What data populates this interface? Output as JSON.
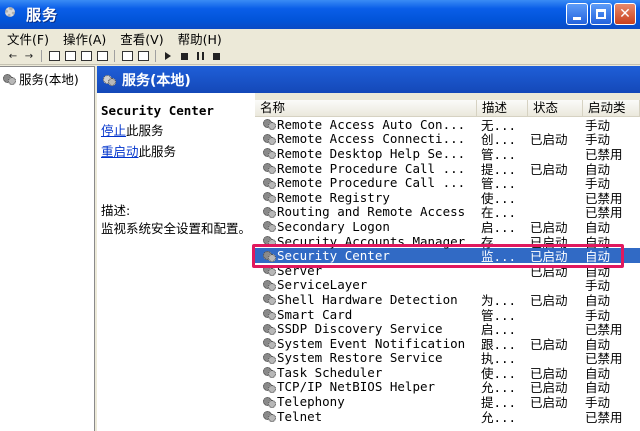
{
  "window": {
    "title": "服务"
  },
  "menu": [
    "文件(F)",
    "操作(A)",
    "查看(V)",
    "帮助(H)"
  ],
  "tree": {
    "root_label": "服务(本地)"
  },
  "panel_header": "服务(本地)",
  "description": {
    "service_name": "Security Center",
    "stop_link": "停止",
    "stop_suffix": "此服务",
    "restart_link": "重启动",
    "restart_suffix": "此服务",
    "label": "描述:",
    "text": "监视系统安全设置和配置。"
  },
  "columns": {
    "name": "名称",
    "desc": "描述",
    "status": "状态",
    "startup": "启动类"
  },
  "services": [
    {
      "name": "Remote Access Auto Con...",
      "desc": "无...",
      "status": "",
      "startup": "手动"
    },
    {
      "name": "Remote Access Connecti...",
      "desc": "创...",
      "status": "已启动",
      "startup": "手动"
    },
    {
      "name": "Remote Desktop Help Se...",
      "desc": "管...",
      "status": "",
      "startup": "已禁用"
    },
    {
      "name": "Remote Procedure Call ...",
      "desc": "提...",
      "status": "已启动",
      "startup": "自动"
    },
    {
      "name": "Remote Procedure Call ...",
      "desc": "管...",
      "status": "",
      "startup": "手动"
    },
    {
      "name": "Remote Registry",
      "desc": "使...",
      "status": "",
      "startup": "已禁用"
    },
    {
      "name": "Routing and Remote Access",
      "desc": "在...",
      "status": "",
      "startup": "已禁用"
    },
    {
      "name": "Secondary Logon",
      "desc": "启...",
      "status": "已启动",
      "startup": "自动"
    },
    {
      "name": "Security Accounts Manager",
      "desc": "存...",
      "status": "已启动",
      "startup": "自动"
    },
    {
      "name": "Security Center",
      "desc": "监...",
      "status": "已启动",
      "startup": "自动"
    },
    {
      "name": "Server",
      "desc": "",
      "status": "已启动",
      "startup": "自动"
    },
    {
      "name": "ServiceLayer",
      "desc": "",
      "status": "",
      "startup": "手动"
    },
    {
      "name": "Shell Hardware Detection",
      "desc": "为...",
      "status": "已启动",
      "startup": "自动"
    },
    {
      "name": "Smart Card",
      "desc": "管...",
      "status": "",
      "startup": "手动"
    },
    {
      "name": "SSDP Discovery Service",
      "desc": "启...",
      "status": "",
      "startup": "已禁用"
    },
    {
      "name": "System Event Notification",
      "desc": "跟...",
      "status": "已启动",
      "startup": "自动"
    },
    {
      "name": "System Restore Service",
      "desc": "执...",
      "status": "",
      "startup": "已禁用"
    },
    {
      "name": "Task Scheduler",
      "desc": "使...",
      "status": "已启动",
      "startup": "自动"
    },
    {
      "name": "TCP/IP NetBIOS Helper",
      "desc": "允...",
      "status": "已启动",
      "startup": "自动"
    },
    {
      "name": "Telephony",
      "desc": "提...",
      "status": "已启动",
      "startup": "手动"
    },
    {
      "name": "Telnet",
      "desc": "允...",
      "status": "",
      "startup": "已禁用"
    }
  ],
  "selected_index": 9,
  "colors": {
    "highlight": "#e0195e",
    "selection": "#316ac5",
    "header_blue": "#1448b8"
  }
}
